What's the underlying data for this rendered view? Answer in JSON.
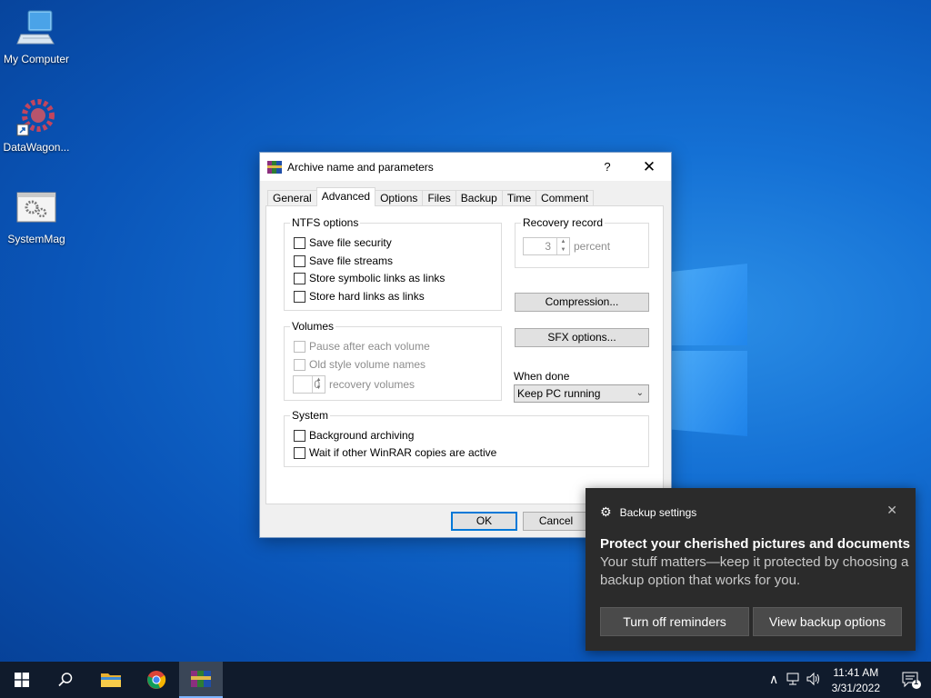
{
  "desktop": {
    "icons": [
      {
        "label": "My Computer",
        "icon": "computer-icon"
      },
      {
        "label": "DataWagon...",
        "icon": "shortcut-gear-icon"
      },
      {
        "label": "SystemMag",
        "icon": "settings-window-icon"
      }
    ]
  },
  "dialog": {
    "title": "Archive name and parameters",
    "help_label": "?",
    "close_label": "✕",
    "tabs": [
      "General",
      "Advanced",
      "Options",
      "Files",
      "Backup",
      "Time",
      "Comment"
    ],
    "active_tab": "Advanced",
    "ntfs": {
      "legend": "NTFS options",
      "items": [
        "Save file security",
        "Save file streams",
        "Store symbolic links as links",
        "Store hard links as links"
      ]
    },
    "volumes": {
      "legend": "Volumes",
      "items": [
        "Pause after each volume",
        "Old style volume names"
      ],
      "recovery_value": "0",
      "recovery_label": "recovery volumes"
    },
    "system": {
      "legend": "System",
      "items": [
        "Background archiving",
        "Wait if other WinRAR copies are active"
      ]
    },
    "recovery_record": {
      "legend": "Recovery record",
      "value": "3",
      "unit": "percent"
    },
    "compression_button": "Compression...",
    "sfx_button": "SFX options...",
    "when_done": {
      "label": "When done",
      "selected": "Keep PC running"
    },
    "ok": "OK",
    "cancel": "Cancel"
  },
  "toast": {
    "app": "Backup settings",
    "close": "✕",
    "heading": "Protect your cherished pictures and documents",
    "body": "Your stuff matters—keep it protected by choosing a backup option that works for you.",
    "button_left": "Turn off reminders",
    "button_right": "View backup options"
  },
  "taskbar": {
    "time": "11:41 AM",
    "date": "3/31/2022",
    "notification_count": "1"
  },
  "colors": {
    "accent": "#0078d7",
    "taskbar": "#101b2c",
    "toast_bg": "#2b2b2b"
  }
}
